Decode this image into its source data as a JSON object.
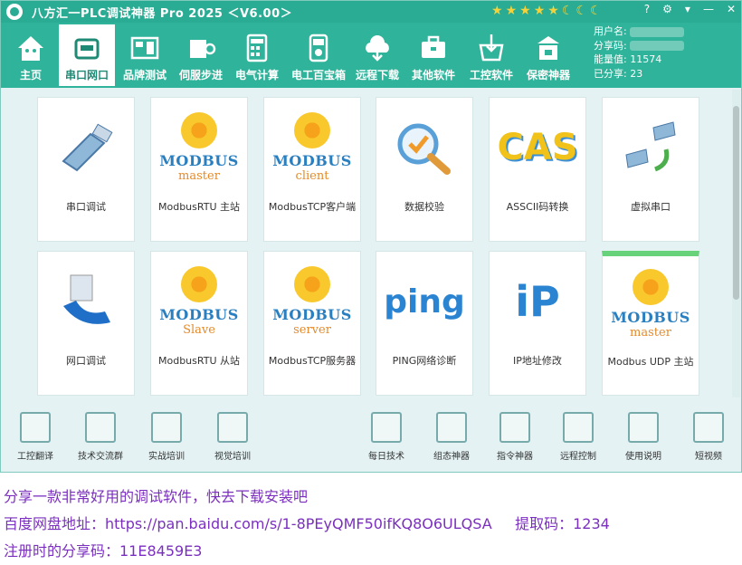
{
  "titlebar": {
    "title": "八方汇一PLC调试神器 Pro 2025 ＜V6.00＞",
    "rating": [
      "★",
      "★",
      "★",
      "★",
      "★",
      "☾",
      "☾",
      "☾"
    ],
    "buttons": [
      "?",
      "⚙",
      "▾",
      "—",
      "✕"
    ]
  },
  "toolbar": {
    "items": [
      {
        "label": "主页",
        "icon": "home-icon"
      },
      {
        "label": "串口网口",
        "icon": "serial-port-icon"
      },
      {
        "label": "品牌测试",
        "icon": "brand-test-icon"
      },
      {
        "label": "伺服步进",
        "icon": "servo-icon"
      },
      {
        "label": "电气计算",
        "icon": "calculator-icon"
      },
      {
        "label": "电工百宝箱",
        "icon": "multimeter-icon"
      },
      {
        "label": "远程下载",
        "icon": "cloud-download-icon"
      },
      {
        "label": "其他软件",
        "icon": "toolbox-icon"
      },
      {
        "label": "工控软件",
        "icon": "download-basket-icon"
      },
      {
        "label": "保密神器",
        "icon": "safe-icon"
      }
    ],
    "user": {
      "username_label": "用户名:",
      "share_code_label": "分享码:",
      "energy_label": "能量值:",
      "energy_value": "11574",
      "shared_label": "已分享:",
      "shared_value": "23"
    }
  },
  "cards": [
    {
      "label": "串口调试",
      "icon": "serial-cable-icon"
    },
    {
      "label": "ModbusRTU 主站",
      "icon": "modbus-master-icon",
      "word": "MODBUS",
      "sub": "master"
    },
    {
      "label": "ModbusTCP客户端",
      "icon": "modbus-client-icon",
      "word": "MODBUS",
      "sub": "client"
    },
    {
      "label": "数据校验",
      "icon": "magnifier-check-icon"
    },
    {
      "label": "ASSCII码转换",
      "icon": "cas-icon",
      "word": "CAS"
    },
    {
      "label": "虚拟串口",
      "icon": "virtual-serial-icon"
    },
    {
      "label": "网口调试",
      "icon": "ethernet-icon"
    },
    {
      "label": "ModbusRTU 从站",
      "icon": "modbus-slave-icon",
      "word": "MODBUS",
      "sub": "Slave"
    },
    {
      "label": "ModbusTCP服务器",
      "icon": "modbus-server-icon",
      "word": "MODBUS",
      "sub": "server"
    },
    {
      "label": "PING网络诊断",
      "icon": "ping-icon",
      "word": "ping"
    },
    {
      "label": "IP地址修改",
      "icon": "ip-icon",
      "word": "iP"
    },
    {
      "label": "Modbus UDP 主站",
      "icon": "modbus-udp-icon",
      "word": "MODBUS",
      "sub": "master"
    }
  ],
  "bottom_tools": [
    {
      "label": "工控翻译",
      "icon": "translate-icon"
    },
    {
      "label": "技术交流群",
      "icon": "chat-group-icon"
    },
    {
      "label": "实战培训",
      "icon": "training-icon"
    },
    {
      "label": "视觉培训",
      "icon": "vision-training-icon"
    },
    {
      "label": "每日技术",
      "icon": "daily-tech-icon"
    },
    {
      "label": "组态神器",
      "icon": "config-icon"
    },
    {
      "label": "指令神器",
      "icon": "instruction-icon"
    },
    {
      "label": "远程控制",
      "icon": "remote-control-icon"
    },
    {
      "label": "使用说明",
      "icon": "manual-icon"
    },
    {
      "label": "短视频",
      "icon": "video-icon"
    }
  ],
  "footer": {
    "line1": "分享一款非常好用的调试软件，快去下载安装吧",
    "line2": "百度网盘地址：https://pan.baidu.com/s/1-8PEyQMF50ifKQ8O6ULQSA     提取码：1234",
    "line3": "注册时的分享码：11E8459E3"
  },
  "colors": {
    "accent": "#2fb39a",
    "footer_text": "#7b2fbf",
    "modbus_blue": "#2a7fc0",
    "modbus_orange": "#e58a2a",
    "selected_bar": "#67d27a"
  }
}
